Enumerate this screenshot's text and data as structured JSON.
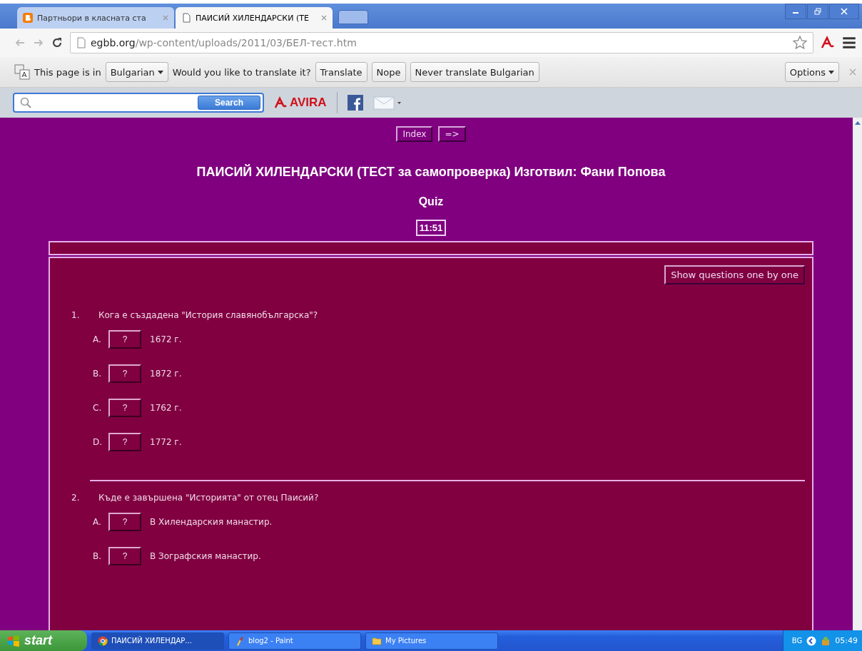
{
  "browser": {
    "tabs": [
      {
        "title": "Партньори в класната ста",
        "kind": "blog",
        "selected": false
      },
      {
        "title": "ПАИСИЙ ХИЛЕНДАРСКИ (ТЕ",
        "kind": "page",
        "selected": true
      }
    ],
    "url": {
      "domain": "egbb.org",
      "path": "/wp-content/uploads/2011/03/БЕЛ-тест.htm"
    }
  },
  "translate_bar": {
    "prefix": "This page is in",
    "language": "Bulgarian",
    "question": "Would you like to translate it?",
    "buttons": [
      "Translate",
      "Nope",
      "Never translate Bulgarian"
    ],
    "options": "Options"
  },
  "avira_bar": {
    "search_button": "Search",
    "brand": "AVIRA"
  },
  "page": {
    "nav": [
      "Index",
      "=>"
    ],
    "title": "ПАИСИЙ ХИЛЕНДАРСКИ (ТЕСТ за самопроверка) Изготвил: Фани Попова",
    "subtitle": "Quiz",
    "timer": "11:51",
    "show_button": "Show questions one by one",
    "questions": [
      {
        "number": "1.",
        "text": "Кога е създадена \"История славянобългарска\"?",
        "options": [
          {
            "letter": "A.",
            "button": "?",
            "text": "1672 г."
          },
          {
            "letter": "B.",
            "button": "?",
            "text": "1872 г."
          },
          {
            "letter": "C.",
            "button": "?",
            "text": "1762 г."
          },
          {
            "letter": "D.",
            "button": "?",
            "text": "1772 г."
          }
        ]
      },
      {
        "number": "2.",
        "text": "Къде е завършена \"Историята\" от отец Паисий?",
        "options": [
          {
            "letter": "A.",
            "button": "?",
            "text": "В Хилендарския манастир."
          },
          {
            "letter": "B.",
            "button": "?",
            "text": "В Зографския манастир."
          }
        ]
      }
    ]
  },
  "taskbar": {
    "start": "start",
    "items": [
      {
        "label": "ПАИСИЙ ХИЛЕНДАР...",
        "kind": "chrome",
        "selected": true
      },
      {
        "label": "blog2 - Paint",
        "kind": "paint",
        "selected": false
      },
      {
        "label": "My Pictures",
        "kind": "folder",
        "selected": false
      }
    ],
    "language": "BG",
    "clock": "05:49"
  }
}
